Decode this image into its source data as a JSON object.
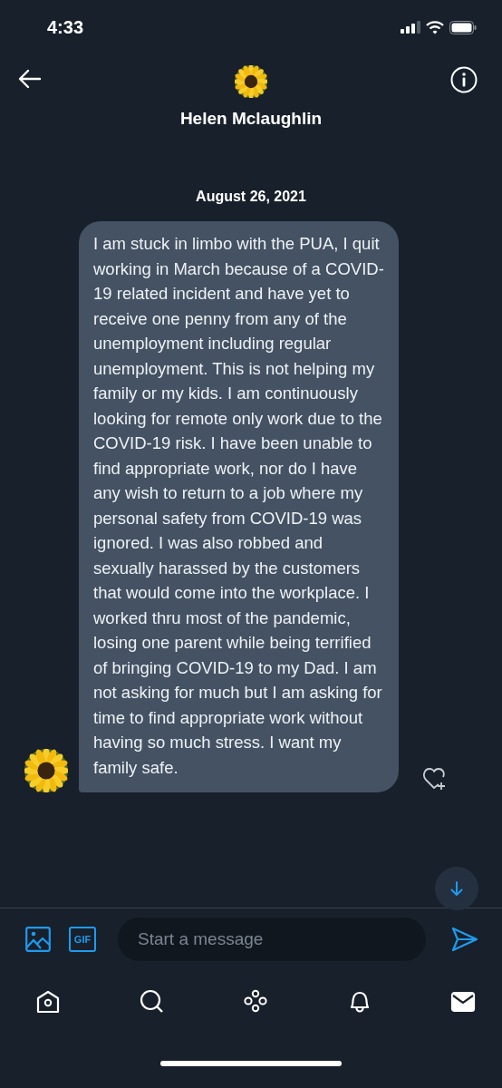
{
  "status_bar": {
    "time": "4:33"
  },
  "header": {
    "name": "Helen Mclaughlin"
  },
  "date": "August 26, 2021",
  "messages": [
    {
      "text": "I am stuck in limbo with the PUA, I quit working in March because of a COVID-19 related incident and have yet to receive one penny from any of the unemployment including regular unemployment. This is not helping my family or my kids. I am continuously looking for remote only work due to the COVID-19 risk. I have been unable to find appropriate work, nor do I have any wish to return to a job where my personal safety from COVID-19 was ignored. I was also robbed and sexually harassed by the customers that would come into the workplace. I worked thru most of the pandemic, losing one parent while being terrified of bringing COVID-19 to my Dad. I am not asking for much but I am asking for time to find appropriate work without having so much stress. I want my family safe."
    }
  ],
  "composer": {
    "gif_label": "GIF",
    "placeholder": "Start a message"
  },
  "tabs": [
    {
      "kind": "home",
      "selected": false
    },
    {
      "kind": "search",
      "selected": false
    },
    {
      "kind": "spaces",
      "selected": false
    },
    {
      "kind": "notifications",
      "selected": false
    },
    {
      "kind": "messages",
      "selected": true
    }
  ]
}
